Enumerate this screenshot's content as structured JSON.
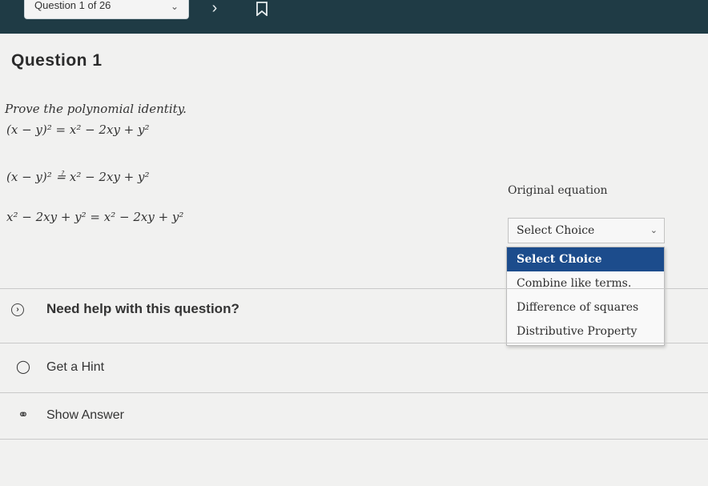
{
  "header": {
    "question_selector": "Question 1 of 26",
    "next_icon": "chevron-right-icon",
    "bookmark_icon": "bookmark-icon"
  },
  "question": {
    "title": "Question 1",
    "prompt": "Prove the polynomial identity.",
    "identity": "(x − y)² = x² − 2xy + y²",
    "step1": "(x − y)² ≟ x² − 2xy + y²",
    "step2": "x² − 2xy + y² = x² − 2xy + y²",
    "reason_label": "Original equation"
  },
  "reason_dropdown": {
    "selected": "Select Choice",
    "options": [
      "Select Choice",
      "Combine like terms.",
      "Difference of squares",
      "Distributive Property"
    ]
  },
  "help": {
    "heading": "Need help with this question?",
    "hint_label": "Get a Hint",
    "answer_label": "Show Answer"
  },
  "colors": {
    "topbar": "#1f3b45",
    "menu_highlight": "#1c4c8c"
  }
}
